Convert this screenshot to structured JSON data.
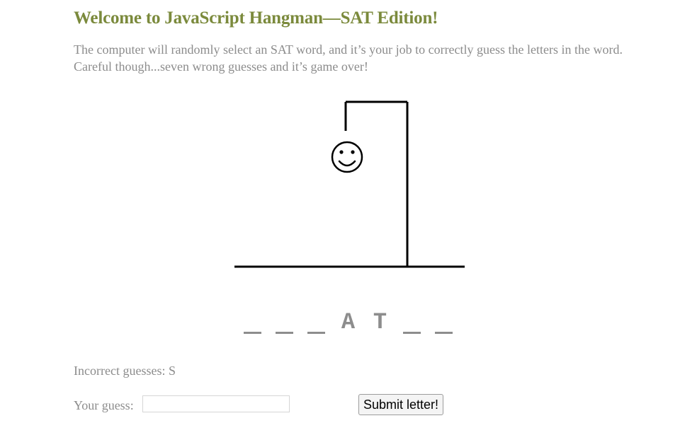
{
  "header": {
    "title": "Welcome to JavaScript Hangman—SAT Edition!",
    "intro": "The computer will randomly select an SAT word, and it’s your job to correctly guess the letters in the word. Careful though...seven wrong guesses and it’s game over!"
  },
  "game": {
    "word_slots": [
      "_",
      "_",
      "_",
      "A",
      "T",
      "_",
      "_"
    ],
    "incorrect_label": "Incorrect guesses: S",
    "face": "smiley-face"
  },
  "form": {
    "guess_label": "Your guess:",
    "guess_value": "",
    "guess_placeholder": "",
    "submit_label": "Submit letter!"
  },
  "colors": {
    "title": "#7b8a3c",
    "text": "#8c8c8c",
    "letters": "#8d8d8d"
  }
}
